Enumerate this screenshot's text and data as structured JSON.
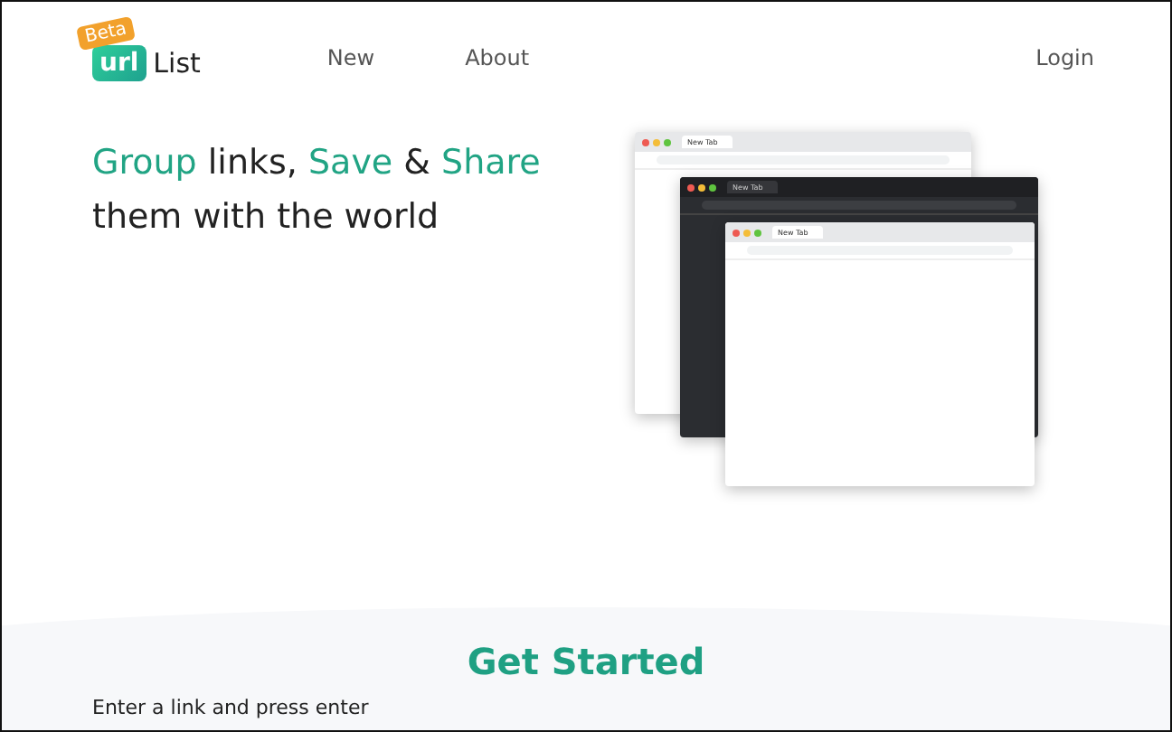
{
  "header": {
    "logo": {
      "badge": "Beta",
      "mark": "url",
      "name": "List"
    },
    "nav": [
      {
        "label": "New"
      },
      {
        "label": "About"
      }
    ],
    "login": "Login"
  },
  "hero": {
    "headline": [
      [
        {
          "text": "Group",
          "accent": true
        },
        {
          "text": " links, ",
          "accent": false
        },
        {
          "text": "Save",
          "accent": true
        },
        {
          "text": " & ",
          "accent": false
        },
        {
          "text": "Share",
          "accent": true
        }
      ],
      [
        {
          "text": "them with the world",
          "accent": false
        }
      ]
    ],
    "windows": [
      {
        "kind": "light",
        "tab_title": "New Tab"
      },
      {
        "kind": "dark",
        "tab_title": "New Tab"
      },
      {
        "kind": "light",
        "tab_title": "New Tab"
      }
    ]
  },
  "get_started": {
    "title": "Get Started",
    "prompt": "Enter a link and press enter"
  }
}
